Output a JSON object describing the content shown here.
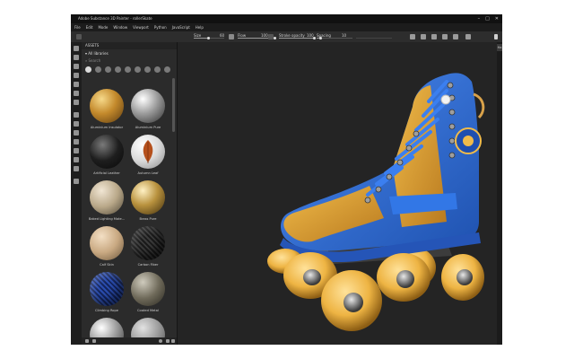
{
  "window": {
    "title": "Adobe Substance 3D Painter - rollerSkate",
    "controls": [
      "–",
      "□",
      "✕"
    ]
  },
  "menu": [
    "File",
    "Edit",
    "Mode",
    "Window",
    "Viewport",
    "Python",
    "JavaScript",
    "Help"
  ],
  "toolbar": {
    "size_label": "Size",
    "size_value": "60",
    "flow_label": "Flow",
    "flow_value": "100",
    "stroke_opacity_label": "Stroke opacity",
    "stroke_opacity_value": "100",
    "spacing_label": "Spacing",
    "spacing_value": "10"
  },
  "shelf": {
    "title": "ASSETS",
    "library": "All libraries",
    "search_placeholder": "Search",
    "assets": [
      {
        "name": "Aluminium Insulator"
      },
      {
        "name": "Aluminium Pure"
      },
      {
        "name": "Artificial Leather"
      },
      {
        "name": "Autumn Leaf"
      },
      {
        "name": "Baked Lighting Mate..."
      },
      {
        "name": "Brass Pure"
      },
      {
        "name": "Calf Skin"
      },
      {
        "name": "Carbon Fiber"
      },
      {
        "name": "Climbing Rope"
      },
      {
        "name": "Coated Metal"
      },
      {
        "name": ""
      },
      {
        "name": ""
      }
    ]
  },
  "right_panel": {
    "tab": "Ha"
  },
  "colors": {
    "skate_blue": "#2f6fd8",
    "skate_yellow": "#e3a531",
    "wheel_yellow": "#f0b847"
  }
}
